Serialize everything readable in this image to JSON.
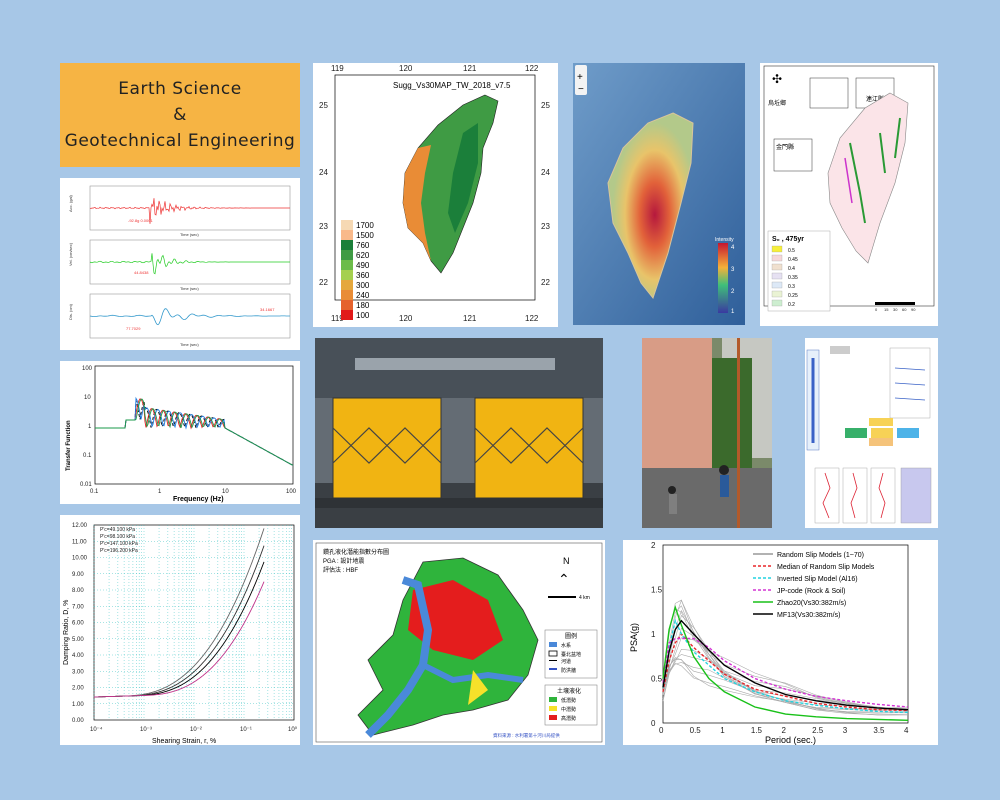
{
  "title": {
    "line1": "Earth Science",
    "line2": "&",
    "line3": "Geotechnical Engineering"
  },
  "records": {
    "labels": [
      "Acc. (gal)",
      "Vel. (cm/sec)",
      "Dis. (cm)"
    ],
    "xlabel": "Time (sec)",
    "ticks": [
      "0",
      "10",
      "20",
      "30",
      "40",
      "50",
      "60",
      "70",
      "80",
      "90"
    ],
    "annots": [
      "-92.8g 0.0001",
      "44.8438",
      "77.7029",
      "34.1667"
    ]
  },
  "vs30map": {
    "title": "Sugg_Vs30MAP_TW_2018_v7.5",
    "xticks": [
      "119",
      "120",
      "121",
      "122"
    ],
    "yticks": [
      "25",
      "24",
      "23",
      "22"
    ],
    "legend": [
      "1700",
      "1500",
      "760",
      "620",
      "490",
      "360",
      "300",
      "240",
      "180",
      "100"
    ],
    "legend_colors": [
      "#f6d9b4",
      "#f9b98a",
      "#1b7f3a",
      "#3f9b44",
      "#6cbc4a",
      "#a5d04f",
      "#e5a83d",
      "#e98c36",
      "#e5622d",
      "#e11a1a"
    ]
  },
  "shake_map": {
    "colorbar": [
      "4",
      "3",
      "2",
      "1"
    ],
    "colorbar_label": "Intensity"
  },
  "hazard_map": {
    "legend_title": "S₀ , 475yr",
    "legend": [
      "0.5",
      "0.45",
      "0.4",
      "0.35",
      "0.3",
      "0.25",
      "0.2"
    ],
    "insets": [
      "烏坵鄉",
      "連江縣",
      "金門縣"
    ],
    "scale": [
      "0",
      "15",
      "30",
      "60",
      "90"
    ]
  },
  "transfer": {
    "ylabel": "Transfer Function",
    "xlabel": "Frequency (Hz)",
    "yticks": [
      "100",
      "10",
      "1",
      "0.1",
      "0.01"
    ],
    "xticks": [
      "0.1",
      "1",
      "10",
      "100"
    ]
  },
  "damping": {
    "ylabel": "Damping Ratio, D, %",
    "xlabel": "Shearing Strain, r, %",
    "yticks": [
      "12.00",
      "11.00",
      "10.00",
      "9.00",
      "8.00",
      "7.00",
      "6.00",
      "5.00",
      "4.00",
      "3.00",
      "2.00",
      "1.00",
      "0.00"
    ],
    "xticks": [
      "10⁻⁴",
      "10⁻³",
      "10⁻²",
      "10⁻¹",
      "10⁰"
    ],
    "legend": [
      "P'c=49.100 kPa",
      "P'c=98.100 kPa",
      "P'c=147.100 kPa",
      "P'c=196.200 kPa"
    ]
  },
  "liq_map": {
    "title": "鑽孔液化潛能指數分布圖",
    "line2": "PGA : 設計地震",
    "line3": "評估法 : HBF",
    "legend_title": "圖例",
    "legend": [
      "水系",
      "臺北盆地",
      "河道",
      "防洪牆"
    ],
    "legend2_title": "土壤液化",
    "legend2": [
      "低潛勢",
      "中潛勢",
      "高潛勢"
    ],
    "north": "N",
    "scale": "4 km",
    "source": "資料來源 : 水利署第十河川局提供"
  },
  "psa_chart": {
    "ylabel": "PSA(g)",
    "xlabel": "Period (sec.)",
    "yticks": [
      "2",
      "1.5",
      "1",
      "0.5",
      "0"
    ],
    "xticks": [
      "0",
      "0.5",
      "1",
      "1.5",
      "2",
      "2.5",
      "3",
      "3.5",
      "4"
    ],
    "legend": [
      "Random Slip Models (1~70)",
      "Median of Random Slip Models",
      "Inverted Slip Model (Al16)",
      "JP-code (Rock & Soil)",
      "Zhao20(Vs30:382m/s)",
      "MF13(Vs30:382m/s)"
    ],
    "colors": [
      "#999999",
      "#e8262a",
      "#22d3e0",
      "#d433d4",
      "#19c119",
      "#000000"
    ]
  },
  "chart_data": {
    "type": "line",
    "title": "",
    "xlabel": "Period (sec.)",
    "ylabel": "PSA(g)",
    "xlim": [
      0,
      4
    ],
    "ylim": [
      0,
      2
    ],
    "x": [
      0,
      0.1,
      0.2,
      0.3,
      0.5,
      0.75,
      1,
      1.5,
      2,
      2.5,
      3,
      3.5,
      4
    ],
    "series": [
      {
        "name": "Median of Random Slip Models",
        "values": [
          0.35,
          0.7,
          0.9,
          1.0,
          0.85,
          0.7,
          0.55,
          0.38,
          0.3,
          0.22,
          0.18,
          0.15,
          0.14
        ]
      },
      {
        "name": "Inverted Slip Model (Al16)",
        "values": [
          0.4,
          0.85,
          1.15,
          1.0,
          0.8,
          0.65,
          0.5,
          0.35,
          0.25,
          0.2,
          0.16,
          0.13,
          0.12
        ]
      },
      {
        "name": "JP-code (Rock & Soil)",
        "values": [
          0.45,
          0.9,
          0.95,
          0.95,
          0.95,
          0.85,
          0.7,
          0.5,
          0.38,
          0.3,
          0.25,
          0.21,
          0.18
        ]
      },
      {
        "name": "Zhao20(Vs30:382m/s)",
        "values": [
          0.5,
          1.05,
          1.3,
          1.1,
          0.75,
          0.5,
          0.35,
          0.18,
          0.1,
          0.07,
          0.05,
          0.04,
          0.03
        ]
      },
      {
        "name": "MF13(Vs30:382m/s)",
        "values": [
          0.4,
          0.8,
          1.05,
          1.15,
          1.0,
          0.82,
          0.65,
          0.45,
          0.32,
          0.25,
          0.2,
          0.17,
          0.15
        ]
      }
    ],
    "grid": false,
    "legend": "top-right"
  }
}
